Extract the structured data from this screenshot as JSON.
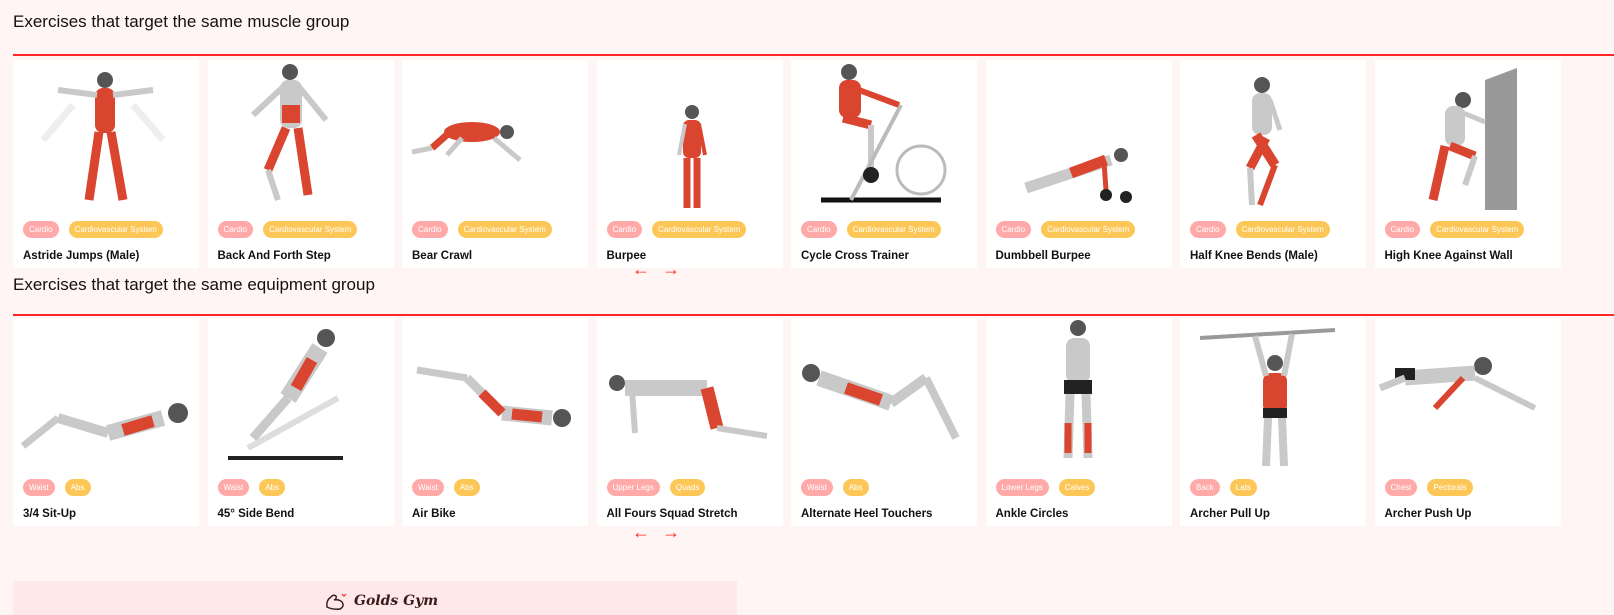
{
  "muscle_section": {
    "title": "Exercises that target the same muscle group",
    "cards": [
      {
        "name": "Astride Jumps (Male)",
        "tags": [
          "Cardio",
          "Cardiovascular System"
        ],
        "pose": "jump"
      },
      {
        "name": "Back And Forth Step",
        "tags": [
          "Cardio",
          "Cardiovascular System"
        ],
        "pose": "step"
      },
      {
        "name": "Bear Crawl",
        "tags": [
          "Cardio",
          "Cardiovascular System"
        ],
        "pose": "crawl"
      },
      {
        "name": "Burpee",
        "tags": [
          "Cardio",
          "Cardiovascular System"
        ],
        "pose": "stand"
      },
      {
        "name": "Cycle Cross Trainer",
        "tags": [
          "Cardio",
          "Cardiovascular System"
        ],
        "pose": "bike"
      },
      {
        "name": "Dumbbell Burpee",
        "tags": [
          "Cardio",
          "Cardiovascular System"
        ],
        "pose": "pushup"
      },
      {
        "name": "Half Knee Bends (Male)",
        "tags": [
          "Cardio",
          "Cardiovascular System"
        ],
        "pose": "squat"
      },
      {
        "name": "High Knee Against Wall",
        "tags": [
          "Cardio",
          "Cardiovascular System"
        ],
        "pose": "wall"
      }
    ],
    "prev_arrow": "←",
    "next_arrow": "→"
  },
  "equipment_section": {
    "title": "Exercises that target the same equipment group",
    "cards": [
      {
        "name": "3/4 Sit-Up",
        "tags": [
          "Waist",
          "Abs"
        ],
        "pose": "situp"
      },
      {
        "name": "45° Side Bend",
        "tags": [
          "Waist",
          "Abs"
        ],
        "pose": "bench"
      },
      {
        "name": "Air Bike",
        "tags": [
          "Waist",
          "Abs"
        ],
        "pose": "airbike"
      },
      {
        "name": "All Fours Squad Stretch",
        "tags": [
          "Upper Legs",
          "Quads"
        ],
        "pose": "allfours"
      },
      {
        "name": "Alternate Heel Touchers",
        "tags": [
          "Waist",
          "Abs"
        ],
        "pose": "heel"
      },
      {
        "name": "Ankle Circles",
        "tags": [
          "Lower Legs",
          "Calves"
        ],
        "pose": "front"
      },
      {
        "name": "Archer Pull Up",
        "tags": [
          "Back",
          "Lats"
        ],
        "pose": "pullup"
      },
      {
        "name": "Archer Push Up",
        "tags": [
          "Chest",
          "Pectorals"
        ],
        "pose": "archerpush"
      }
    ],
    "prev_arrow": "←",
    "next_arrow": "→"
  },
  "footer": {
    "logo_text": "Golds Gym"
  },
  "colors": {
    "accent": "#ff2625",
    "body_tag": "#ffa9a9",
    "target_tag": "#fcc757",
    "muscle": "#d9452f",
    "skin": "#c9c9c9"
  }
}
